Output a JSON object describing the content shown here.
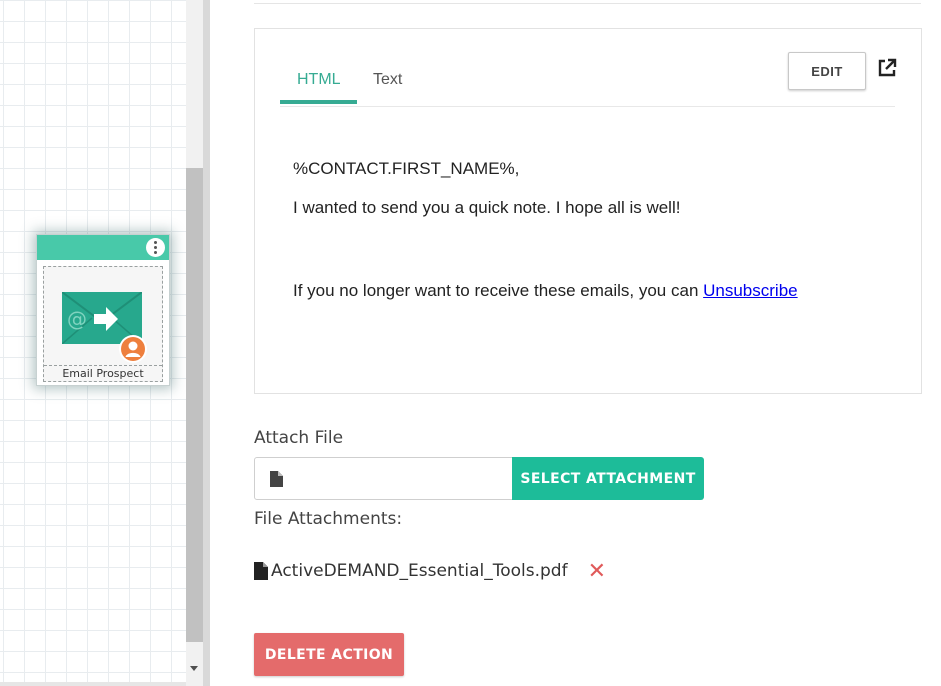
{
  "canvas": {
    "node": {
      "label": "Email Prospect",
      "header_color": "#48c9a9",
      "icon": "email-envelope-icon",
      "badge_icon": "contact-avatar-icon"
    }
  },
  "email_preview": {
    "tabs": [
      {
        "label": "HTML",
        "active": true
      },
      {
        "label": "Text",
        "active": false
      }
    ],
    "edit_label": "EDIT",
    "popout_icon": "external-link-icon",
    "body": {
      "line1": "%CONTACT.FIRST_NAME%,",
      "line2": "I wanted to send you  a quick note. I hope all is well!",
      "line3_prefix": "If you no longer want to receive these emails, you can ",
      "unsubscribe_link": "Unsubscribe"
    }
  },
  "attach": {
    "label": "Attach File",
    "input_value": "",
    "select_button": "SELECT ATTACHMENT",
    "file_icon": "file-icon"
  },
  "attachments": {
    "label": "File Attachments:",
    "items": [
      {
        "name": "ActiveDEMAND_Essential_Tools.pdf",
        "remove_icon": "close-x-icon"
      }
    ]
  },
  "delete_label": "DELETE ACTION",
  "colors": {
    "accent": "#36ab93",
    "primary_button": "#1dbc99",
    "danger_button": "#e46b6b",
    "remove_icon": "#e05a5a",
    "link": "#0000ee"
  }
}
